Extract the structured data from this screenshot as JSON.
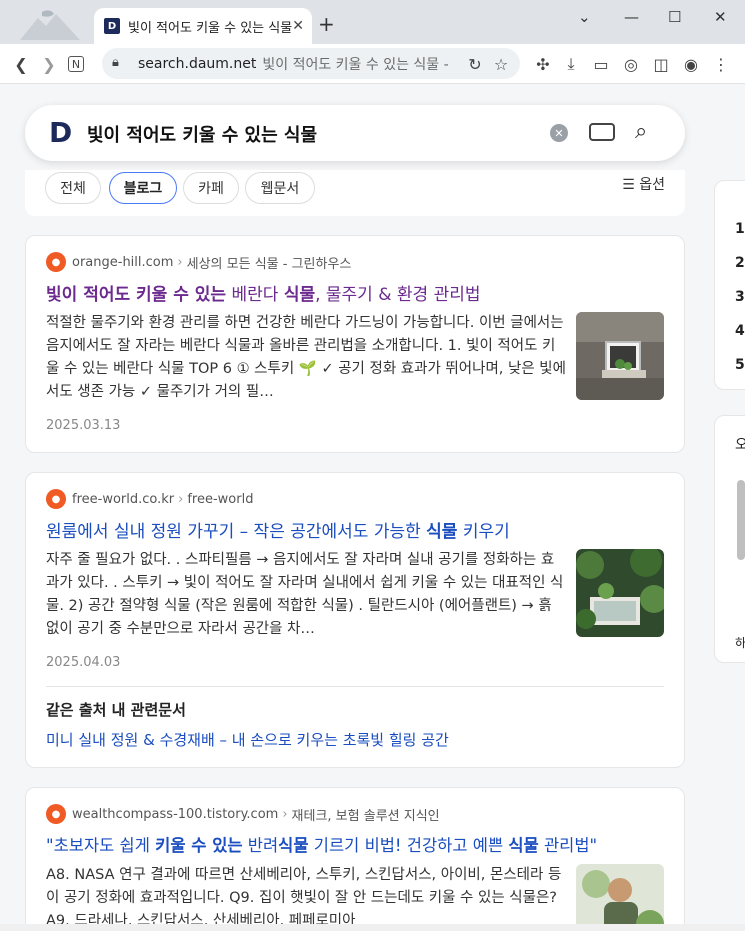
{
  "window": {
    "tab_title": "빛이 적어도 키울 수 있는 식물",
    "favicon_letter": "D",
    "new_tab": "+",
    "minimize": "—",
    "maximize": "☐",
    "close": "✕",
    "tab_close": "✕"
  },
  "toolbar": {
    "url_host": "search.daum.net",
    "url_query": "빛이 적어도 키울 수 있는 식물 -"
  },
  "search": {
    "logo": "D",
    "query": "빛이 적어도 키울 수 있는 식물"
  },
  "filters": {
    "tabs": [
      "전체",
      "블로그",
      "카페",
      "웹문서"
    ],
    "active": "블로그",
    "options_label": "옵션"
  },
  "results": [
    {
      "source": "orange-hill.com",
      "source_sub": "세상의 모든 식물 - 그린하우스",
      "title_parts": [
        "빛이 적어도 키울 수 있는",
        " 베란다 ",
        "식물",
        ", 물주기 & 환경 관리법"
      ],
      "snippet": "적절한 물주기와 환경 관리를 하면 건강한 베란다 가드닝이 가능합니다. 이번 글에서는 음지에서도 잘 자라는 베란다 식물과 올바른 관리법을 소개합니다. 1. 빛이 적어도 키울 수 있는 베란다 식물 TOP 6 ① 스투키 🌱 ✓ 공기 정화 효과가 뛰어나며, 낮은 빛에서도 생존 가능 ✓ 물주기가 거의 필…",
      "date": "2025.03.13"
    },
    {
      "source": "free-world.co.kr",
      "source_sub": "free-world",
      "title_parts": [
        "원룸에서 실내 정원 가꾸기 – 작은 공간에서도 가능한 ",
        "식물",
        " 키우기"
      ],
      "snippet": "자주 줄 필요가 없다. . 스파티필름 → 음지에서도 잘 자라며 실내 공기를 정화하는 효과가 있다. . 스투키 → 빛이 적어도 잘 자라며 실내에서 쉽게 키울 수 있는 대표적인 식물. 2) 공간 절약형 식물 (작은 원룸에 적합한 식물) . 틸란드시아 (에어플랜트) → 흙 없이 공기 중 수분만으로 자라서 공간을 차…",
      "date": "2025.04.03",
      "related_heading": "같은 출처 내 관련문서",
      "related_link": "미니 실내 정원 & 수경재배 – 내 손으로 키우는 초록빛 힐링 공간"
    },
    {
      "source": "wealthcompass-100.tistory.com",
      "source_sub": "재테크, 보험 솔루션 지식인",
      "title_parts": [
        "\"초보자도 쉽게 ",
        "키울 수 있는",
        " 반려",
        "식물",
        " 기르기 비법! 건강하고 예쁜 ",
        "식물",
        " 관리법\""
      ],
      "snippet": "A8. NASA 연구 결과에 따르면 산세베리아, 스투키, 스킨답서스, 아이비, 몬스테라 등이 공기 정화에 효과적입니다. Q9. 집이 햇빛이 잘 안 드는데도 키울 수 있는 식물은? A9. 드라세나, 스킨답서스, 산세베리아, 페페로미아"
    }
  ],
  "sidebar": {
    "numbers": [
      "1",
      "2",
      "3",
      "4",
      "5"
    ],
    "letter": "오",
    "letter2": "하"
  }
}
